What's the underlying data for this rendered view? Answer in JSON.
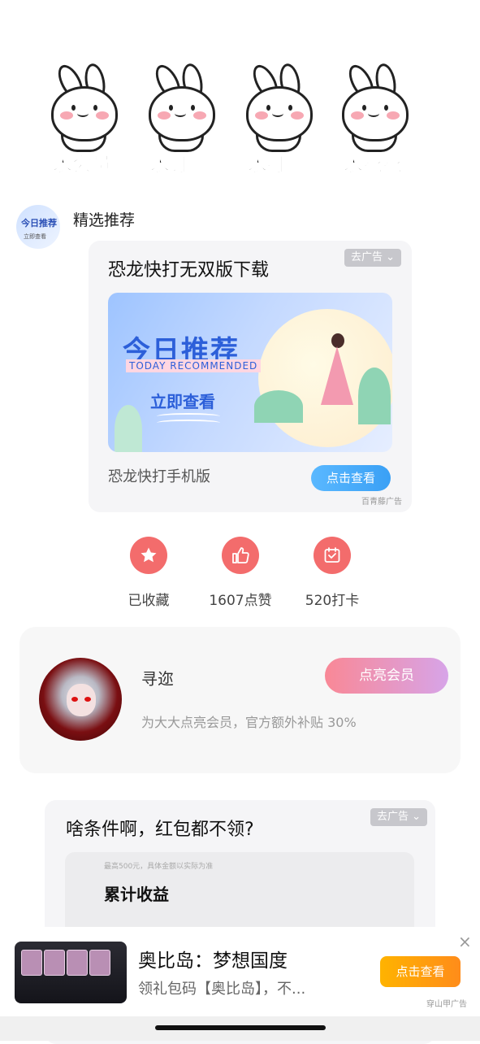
{
  "stickers": [
    "求会员",
    "求订阅",
    "求打赏",
    "求花花"
  ],
  "recommend": {
    "avatar_text_main": "今日推荐",
    "avatar_text_sub": "立即查看",
    "title": "精选推荐"
  },
  "ad_card_1": {
    "tag": "去广告",
    "title": "恐龙快打无双版下载",
    "banner_main": "今日推荐",
    "banner_sub": "TODAY RECOMMENDED",
    "banner_cta": "立即查看",
    "subtitle": "恐龙快打手机版",
    "button": "点击查看",
    "source": "百青藤广告"
  },
  "actions": [
    {
      "icon": "star-icon",
      "label": "已收藏"
    },
    {
      "icon": "thumbs-up-icon",
      "label": "1607点赞"
    },
    {
      "icon": "calendar-check-icon",
      "label": "520打卡"
    }
  ],
  "member": {
    "name": "寻迩",
    "description": "为大大点亮会员，官方额外补贴 30%",
    "button": "点亮会员"
  },
  "ad_card_2": {
    "tag": "去广告",
    "title": "啥条件啊，红包都不领?",
    "small_note": "最高500元，具体金额以实际为准",
    "earnings_label": "累计收益"
  },
  "bottom_ad": {
    "title": "奥比岛：梦想国度",
    "description": "领礼包码【奥比岛】，不...",
    "button": "点击查看",
    "close": "×",
    "source": "穿山甲广告"
  },
  "colors": {
    "action_red": "#f36c6c",
    "vip_gradient_start": "#f98896",
    "vip_gradient_end": "#d7a4e8",
    "cta_blue": "#3aa0f5",
    "cta_orange": "#ff8c1a"
  }
}
